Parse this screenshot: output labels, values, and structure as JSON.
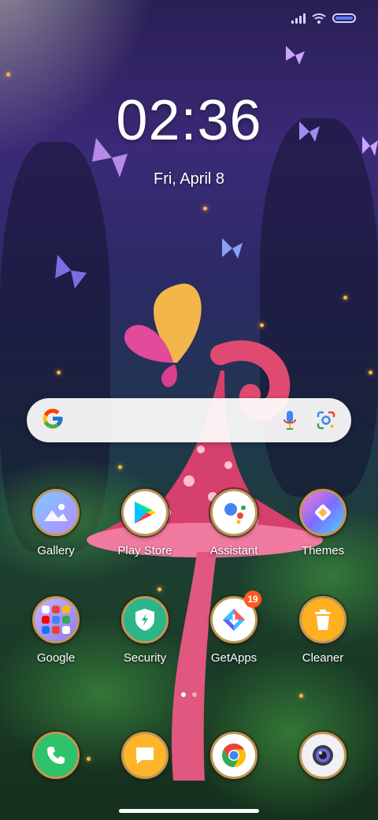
{
  "status_bar": {
    "battery_color": "#5c7cf5"
  },
  "clock": {
    "time": "02:36",
    "date": "Fri, April 8"
  },
  "search": {
    "placeholder": ""
  },
  "apps_row1": [
    {
      "label": "Gallery",
      "icon": "gallery-icon"
    },
    {
      "label": "Play Store",
      "icon": "play-store-icon"
    },
    {
      "label": "Assistant",
      "icon": "assistant-icon"
    },
    {
      "label": "Themes",
      "icon": "themes-icon"
    }
  ],
  "apps_row2": [
    {
      "label": "Google",
      "icon": "google-folder-icon"
    },
    {
      "label": "Security",
      "icon": "security-icon"
    },
    {
      "label": "GetApps",
      "icon": "getapps-icon",
      "badge": "19"
    },
    {
      "label": "Cleaner",
      "icon": "cleaner-icon"
    }
  ],
  "dock": [
    {
      "icon": "phone-icon"
    },
    {
      "icon": "messages-icon"
    },
    {
      "icon": "chrome-icon"
    },
    {
      "icon": "camera-icon"
    }
  ],
  "pages": {
    "total": 2,
    "active": 1
  }
}
